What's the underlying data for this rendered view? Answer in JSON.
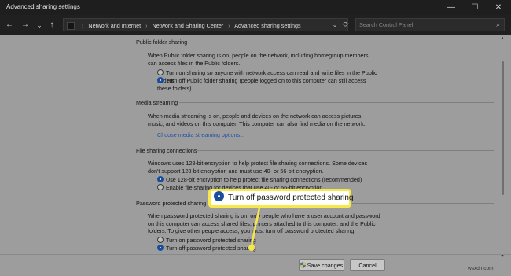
{
  "window": {
    "title": "Advanced sharing settings"
  },
  "titlebar_buttons": {
    "minimize": "—",
    "maximize": "☐",
    "close": "✕"
  },
  "nav": {
    "back": "←",
    "forward": "→",
    "dropdown": "⌄",
    "up": "↑",
    "breadcrumbs": [
      "Network and Internet",
      "Network and Sharing Center",
      "Advanced sharing settings"
    ],
    "separator": "›",
    "address_chevron": "⌄",
    "refresh": "⟳",
    "search_placeholder": "Search Control Panel",
    "search_icon": "⌕"
  },
  "sections": {
    "public": {
      "heading": "Public folder sharing",
      "desc": "When Public folder sharing is on, people on the network, including homegroup members, can access files in the Public folders.",
      "options": [
        {
          "label": "Turn on sharing so anyone with network access can read and write files in the Public folders",
          "selected": false
        },
        {
          "label": "Turn off Public folder sharing (people logged on to this computer can still access these folders)",
          "selected": true
        }
      ]
    },
    "media": {
      "heading": "Media streaming",
      "desc": "When media streaming is on, people and devices on the network can access pictures, music, and videos on this computer. This computer can also find media on the network.",
      "link": "Choose media streaming options..."
    },
    "file": {
      "heading": "File sharing connections",
      "desc": "Windows uses 128-bit encryption to help protect file sharing connections. Some devices don't support 128-bit encryption and must use 40- or 56-bit encryption.",
      "options": [
        {
          "label": "Use 128-bit encryption to help protect file sharing connections (recommended)",
          "selected": true
        },
        {
          "label": "Enable file sharing for devices that use 40- or 56-bit encryption",
          "selected": false
        }
      ]
    },
    "password": {
      "heading": "Password protected sharing",
      "desc": "When password protected sharing is on, only people who have a user account and password on this computer can access shared files, printers attached to this computer, and the Public folders. To give other people access, you must turn off password protected sharing.",
      "options": [
        {
          "label": "Turn on password protected sharing",
          "selected": false
        },
        {
          "label": "Turn off password protected sharing",
          "selected": true
        }
      ]
    }
  },
  "callout": {
    "label": "Turn off password protected sharing"
  },
  "buttons": {
    "save": "Save changes",
    "cancel": "Cancel"
  },
  "watermark": "wsxdn.com",
  "colors": {
    "accent": "#1a4e9c",
    "highlight": "#f7e84a",
    "link": "#2150a8"
  }
}
